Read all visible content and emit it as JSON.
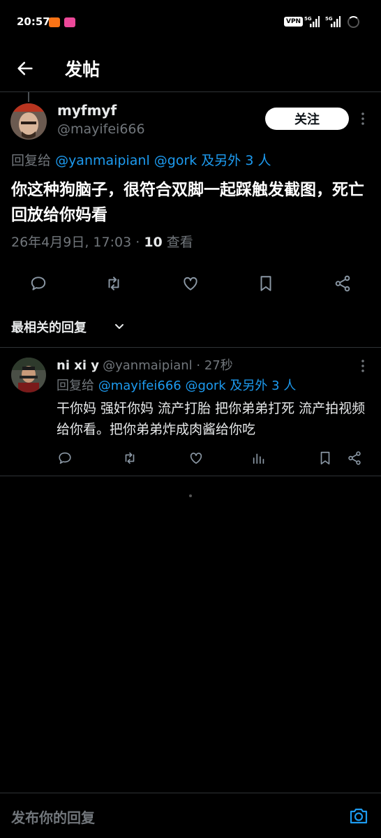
{
  "status_bar": {
    "time": "20:57",
    "vpn": "VPN",
    "net1": "5G",
    "net2": "5G"
  },
  "header": {
    "title": "发帖"
  },
  "post": {
    "display_name": "myfmyf",
    "handle": "@mayifei666",
    "follow_label": "关注",
    "reply_prefix": "回复给",
    "reply_mentions": "@yanmaipianl @gork 及另外 3 人",
    "text": "你这种狗脑子，很符合双脚一起踩触发截图，死亡回放给你妈看",
    "timestamp": "26年4月9日, 17:03 · ",
    "views_count": "10",
    "views_label": " 查看"
  },
  "sort": {
    "label": "最相关的回复"
  },
  "reply": {
    "display_name": "ni xi y",
    "handle_time": "@yanmaipianl · 27秒",
    "reply_prefix": "回复给",
    "reply_mentions": "@mayifei666 @gork 及另外 3 人",
    "text": "干你妈 强奸你妈 流产打胎 把你弟弟打死 流产拍视频给你看。把你弟弟炸成肉酱给你吃"
  },
  "compose": {
    "placeholder": "发布你的回复"
  },
  "colors": {
    "accent": "#1d9bf0",
    "muted": "#71767b",
    "background": "#000000"
  },
  "icons": [
    "back-arrow-icon",
    "more-vertical-icon",
    "reply-icon",
    "retweet-icon",
    "like-icon",
    "bookmark-icon",
    "share-icon",
    "views-icon",
    "chevron-down-icon",
    "camera-icon"
  ]
}
